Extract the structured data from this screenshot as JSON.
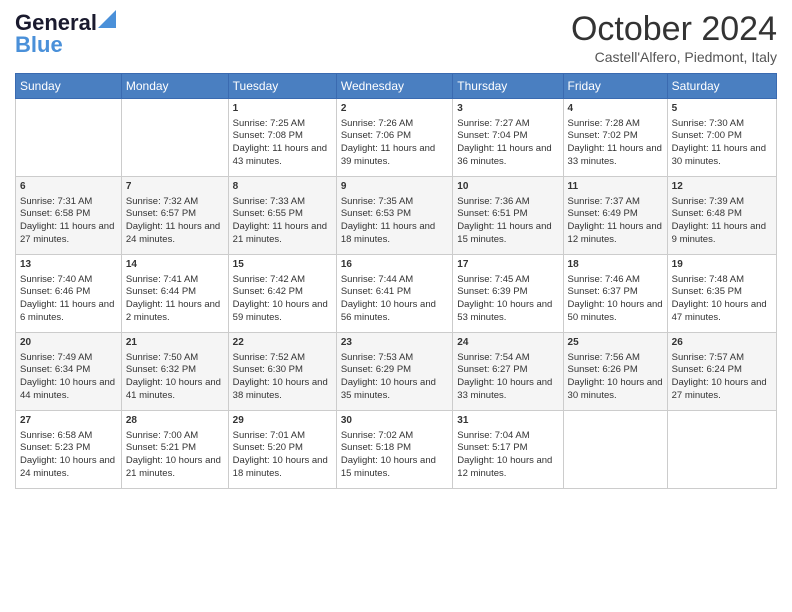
{
  "logo": {
    "part1": "General",
    "part2": "Blue"
  },
  "header": {
    "month": "October 2024",
    "location": "Castell'Alfero, Piedmont, Italy"
  },
  "weekdays": [
    "Sunday",
    "Monday",
    "Tuesday",
    "Wednesday",
    "Thursday",
    "Friday",
    "Saturday"
  ],
  "weeks": [
    [
      {
        "day": "",
        "info": ""
      },
      {
        "day": "",
        "info": ""
      },
      {
        "day": "1",
        "sunrise": "Sunrise: 7:25 AM",
        "sunset": "Sunset: 7:08 PM",
        "daylight": "Daylight: 11 hours and 43 minutes."
      },
      {
        "day": "2",
        "sunrise": "Sunrise: 7:26 AM",
        "sunset": "Sunset: 7:06 PM",
        "daylight": "Daylight: 11 hours and 39 minutes."
      },
      {
        "day": "3",
        "sunrise": "Sunrise: 7:27 AM",
        "sunset": "Sunset: 7:04 PM",
        "daylight": "Daylight: 11 hours and 36 minutes."
      },
      {
        "day": "4",
        "sunrise": "Sunrise: 7:28 AM",
        "sunset": "Sunset: 7:02 PM",
        "daylight": "Daylight: 11 hours and 33 minutes."
      },
      {
        "day": "5",
        "sunrise": "Sunrise: 7:30 AM",
        "sunset": "Sunset: 7:00 PM",
        "daylight": "Daylight: 11 hours and 30 minutes."
      }
    ],
    [
      {
        "day": "6",
        "sunrise": "Sunrise: 7:31 AM",
        "sunset": "Sunset: 6:58 PM",
        "daylight": "Daylight: 11 hours and 27 minutes."
      },
      {
        "day": "7",
        "sunrise": "Sunrise: 7:32 AM",
        "sunset": "Sunset: 6:57 PM",
        "daylight": "Daylight: 11 hours and 24 minutes."
      },
      {
        "day": "8",
        "sunrise": "Sunrise: 7:33 AM",
        "sunset": "Sunset: 6:55 PM",
        "daylight": "Daylight: 11 hours and 21 minutes."
      },
      {
        "day": "9",
        "sunrise": "Sunrise: 7:35 AM",
        "sunset": "Sunset: 6:53 PM",
        "daylight": "Daylight: 11 hours and 18 minutes."
      },
      {
        "day": "10",
        "sunrise": "Sunrise: 7:36 AM",
        "sunset": "Sunset: 6:51 PM",
        "daylight": "Daylight: 11 hours and 15 minutes."
      },
      {
        "day": "11",
        "sunrise": "Sunrise: 7:37 AM",
        "sunset": "Sunset: 6:49 PM",
        "daylight": "Daylight: 11 hours and 12 minutes."
      },
      {
        "day": "12",
        "sunrise": "Sunrise: 7:39 AM",
        "sunset": "Sunset: 6:48 PM",
        "daylight": "Daylight: 11 hours and 9 minutes."
      }
    ],
    [
      {
        "day": "13",
        "sunrise": "Sunrise: 7:40 AM",
        "sunset": "Sunset: 6:46 PM",
        "daylight": "Daylight: 11 hours and 6 minutes."
      },
      {
        "day": "14",
        "sunrise": "Sunrise: 7:41 AM",
        "sunset": "Sunset: 6:44 PM",
        "daylight": "Daylight: 11 hours and 2 minutes."
      },
      {
        "day": "15",
        "sunrise": "Sunrise: 7:42 AM",
        "sunset": "Sunset: 6:42 PM",
        "daylight": "Daylight: 10 hours and 59 minutes."
      },
      {
        "day": "16",
        "sunrise": "Sunrise: 7:44 AM",
        "sunset": "Sunset: 6:41 PM",
        "daylight": "Daylight: 10 hours and 56 minutes."
      },
      {
        "day": "17",
        "sunrise": "Sunrise: 7:45 AM",
        "sunset": "Sunset: 6:39 PM",
        "daylight": "Daylight: 10 hours and 53 minutes."
      },
      {
        "day": "18",
        "sunrise": "Sunrise: 7:46 AM",
        "sunset": "Sunset: 6:37 PM",
        "daylight": "Daylight: 10 hours and 50 minutes."
      },
      {
        "day": "19",
        "sunrise": "Sunrise: 7:48 AM",
        "sunset": "Sunset: 6:35 PM",
        "daylight": "Daylight: 10 hours and 47 minutes."
      }
    ],
    [
      {
        "day": "20",
        "sunrise": "Sunrise: 7:49 AM",
        "sunset": "Sunset: 6:34 PM",
        "daylight": "Daylight: 10 hours and 44 minutes."
      },
      {
        "day": "21",
        "sunrise": "Sunrise: 7:50 AM",
        "sunset": "Sunset: 6:32 PM",
        "daylight": "Daylight: 10 hours and 41 minutes."
      },
      {
        "day": "22",
        "sunrise": "Sunrise: 7:52 AM",
        "sunset": "Sunset: 6:30 PM",
        "daylight": "Daylight: 10 hours and 38 minutes."
      },
      {
        "day": "23",
        "sunrise": "Sunrise: 7:53 AM",
        "sunset": "Sunset: 6:29 PM",
        "daylight": "Daylight: 10 hours and 35 minutes."
      },
      {
        "day": "24",
        "sunrise": "Sunrise: 7:54 AM",
        "sunset": "Sunset: 6:27 PM",
        "daylight": "Daylight: 10 hours and 33 minutes."
      },
      {
        "day": "25",
        "sunrise": "Sunrise: 7:56 AM",
        "sunset": "Sunset: 6:26 PM",
        "daylight": "Daylight: 10 hours and 30 minutes."
      },
      {
        "day": "26",
        "sunrise": "Sunrise: 7:57 AM",
        "sunset": "Sunset: 6:24 PM",
        "daylight": "Daylight: 10 hours and 27 minutes."
      }
    ],
    [
      {
        "day": "27",
        "sunrise": "Sunrise: 6:58 AM",
        "sunset": "Sunset: 5:23 PM",
        "daylight": "Daylight: 10 hours and 24 minutes."
      },
      {
        "day": "28",
        "sunrise": "Sunrise: 7:00 AM",
        "sunset": "Sunset: 5:21 PM",
        "daylight": "Daylight: 10 hours and 21 minutes."
      },
      {
        "day": "29",
        "sunrise": "Sunrise: 7:01 AM",
        "sunset": "Sunset: 5:20 PM",
        "daylight": "Daylight: 10 hours and 18 minutes."
      },
      {
        "day": "30",
        "sunrise": "Sunrise: 7:02 AM",
        "sunset": "Sunset: 5:18 PM",
        "daylight": "Daylight: 10 hours and 15 minutes."
      },
      {
        "day": "31",
        "sunrise": "Sunrise: 7:04 AM",
        "sunset": "Sunset: 5:17 PM",
        "daylight": "Daylight: 10 hours and 12 minutes."
      },
      {
        "day": "",
        "info": ""
      },
      {
        "day": "",
        "info": ""
      }
    ]
  ]
}
